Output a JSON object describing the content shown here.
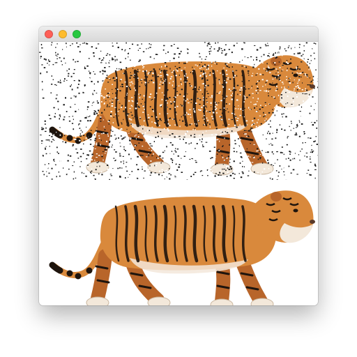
{
  "window": {
    "traffic_lights": {
      "close": "#ff5f57",
      "minimize": "#febc2e",
      "zoom": "#28c840"
    }
  },
  "images": {
    "top": {
      "subject": "tiger",
      "variant": "salt-and-pepper noise"
    },
    "bottom": {
      "subject": "tiger",
      "variant": "clean"
    }
  },
  "colors": {
    "tiger_fur": "#d9893c",
    "tiger_fur_dark": "#b8652a",
    "tiger_belly": "#f3e8da",
    "stripe": "#1e140d",
    "noise_dark": "#1a1a1a",
    "noise_light": "#ffffff"
  }
}
